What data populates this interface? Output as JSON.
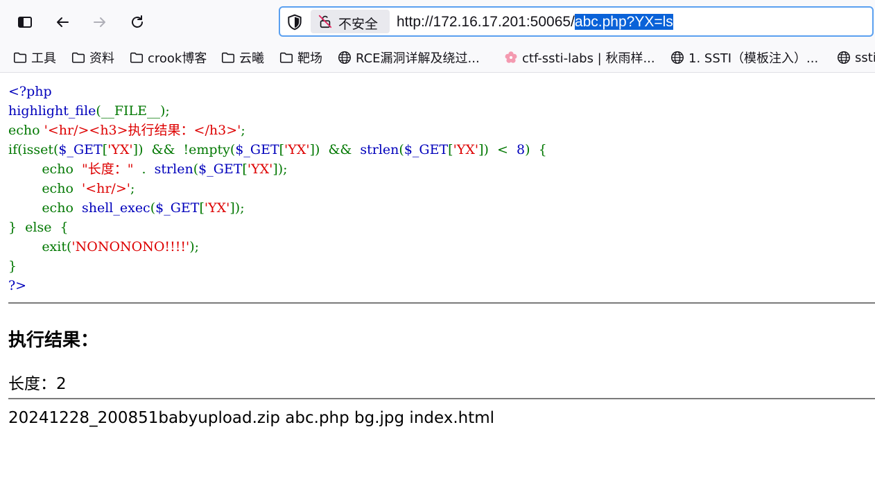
{
  "browser": {
    "security_label": "不安全",
    "url_base": "http://172.16.17.201:50065/",
    "url_selected": "abc.php?YX=ls",
    "icons": {
      "sidebar": "sidebar-icon",
      "back": "back-arrow-icon",
      "forward": "forward-arrow-icon",
      "reload": "reload-icon",
      "shield": "shield-icon",
      "insecure": "insecure-lock-icon"
    },
    "accent_color": "#0a62d8"
  },
  "bookmarks": [
    {
      "label": "工具",
      "icon": "folder-icon"
    },
    {
      "label": "资料",
      "icon": "folder-icon"
    },
    {
      "label": "crook博客",
      "icon": "folder-icon"
    },
    {
      "label": "云曦",
      "icon": "folder-icon"
    },
    {
      "label": "靶场",
      "icon": "folder-icon"
    },
    {
      "label": "RCE漏洞详解及绕过...",
      "icon": "globe-icon"
    },
    {
      "label": "ctf-ssti-labs | 秋雨样...",
      "icon": "flower-icon"
    },
    {
      "label": "1. SSTI（模板注入）...",
      "icon": "globe-icon"
    },
    {
      "label": "ssti",
      "icon": "globe-icon"
    }
  ],
  "source": {
    "line1": "<?php",
    "line2a": "highlight_file",
    "line2b": "(__FILE__);",
    "line3a": "echo ",
    "line3b": "'<hr/><h3>执行结果：</h3>'",
    "line3c": ";",
    "line4a": "if(isset(",
    "line4b": "$_GET",
    "line4c": "[",
    "line4d": "'YX'",
    "line4e": "])  &&  !empty(",
    "line4f": "$_GET",
    "line4g": "[",
    "line4h": "'YX'",
    "line4i": "])  &&  ",
    "line4j": "strlen",
    "line4k": "(",
    "line4l": "$_GET",
    "line4m": "[",
    "line4n": "'YX'",
    "line4o": "])  <  ",
    "line4p": "8",
    "line4q": ")  {",
    "line5a": "        echo  ",
    "line5b": "\"长度：\"",
    "line5c": "  .  ",
    "line5d": "strlen",
    "line5e": "(",
    "line5f": "$_GET",
    "line5g": "[",
    "line5h": "'YX'",
    "line5i": "]);",
    "line6a": "        echo  ",
    "line6b": "'<hr/>'",
    "line6c": ";",
    "line7a": "        echo  ",
    "line7b": "shell_exec",
    "line7c": "(",
    "line7d": "$_GET",
    "line7e": "[",
    "line7f": "'YX'",
    "line7g": "]);",
    "line8": "}  else  {",
    "line9a": "        exit(",
    "line9b": "'NONONONO!!!!'",
    "line9c": ");",
    "line10": "}",
    "line11": "?>"
  },
  "result": {
    "heading": "执行结果：",
    "length_text": "长度：2",
    "output": "20241228_200851babyupload.zip abc.php bg.jpg index.html"
  }
}
